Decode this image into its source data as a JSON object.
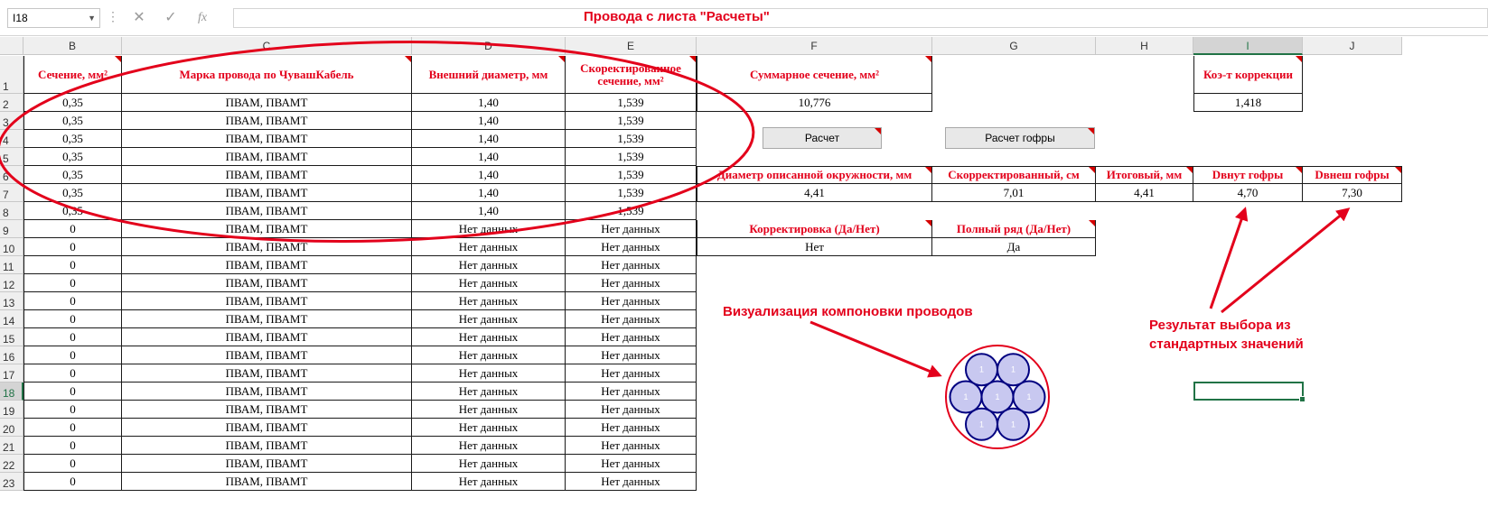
{
  "formula_bar": {
    "name_box": "I18",
    "cancel_icon": "✕",
    "enter_icon": "✓",
    "fx_icon": "fx",
    "separator": "⋮"
  },
  "columns": [
    "B",
    "C",
    "D",
    "E",
    "F",
    "G",
    "H",
    "I",
    "J"
  ],
  "rows": [
    "1",
    "2",
    "3",
    "4",
    "5",
    "6",
    "7",
    "8",
    "9",
    "10",
    "11",
    "12",
    "13",
    "14",
    "15",
    "16",
    "17",
    "18",
    "19",
    "20",
    "21",
    "22",
    "23"
  ],
  "table": {
    "headers": [
      "Сечение, мм²",
      "Марка провода по ЧувашКабель",
      "Внешний диаметр, мм",
      "Скоректированное сечение, мм²"
    ],
    "rows": [
      [
        "0,35",
        "ПВАМ, ПВАМТ",
        "1,40",
        "1,539"
      ],
      [
        "0,35",
        "ПВАМ, ПВАМТ",
        "1,40",
        "1,539"
      ],
      [
        "0,35",
        "ПВАМ, ПВАМТ",
        "1,40",
        "1,539"
      ],
      [
        "0,35",
        "ПВАМ, ПВАМТ",
        "1,40",
        "1,539"
      ],
      [
        "0,35",
        "ПВАМ, ПВАМТ",
        "1,40",
        "1,539"
      ],
      [
        "0,35",
        "ПВАМ, ПВАМТ",
        "1,40",
        "1,539"
      ],
      [
        "0,35",
        "ПВАМ, ПВАМТ",
        "1,40",
        "1,539"
      ],
      [
        "0",
        "ПВАМ, ПВАМТ",
        "Нет данных",
        "Нет данных"
      ],
      [
        "0",
        "ПВАМ, ПВАМТ",
        "Нет данных",
        "Нет данных"
      ],
      [
        "0",
        "ПВАМ, ПВАМТ",
        "Нет данных",
        "Нет данных"
      ],
      [
        "0",
        "ПВАМ, ПВАМТ",
        "Нет данных",
        "Нет данных"
      ],
      [
        "0",
        "ПВАМ, ПВАМТ",
        "Нет данных",
        "Нет данных"
      ],
      [
        "0",
        "ПВАМ, ПВАМТ",
        "Нет данных",
        "Нет данных"
      ],
      [
        "0",
        "ПВАМ, ПВАМТ",
        "Нет данных",
        "Нет данных"
      ],
      [
        "0",
        "ПВАМ, ПВАМТ",
        "Нет данных",
        "Нет данных"
      ],
      [
        "0",
        "ПВАМ, ПВАМТ",
        "Нет данных",
        "Нет данных"
      ],
      [
        "0",
        "ПВАМ, ПВАМТ",
        "Нет данных",
        "Нет данных"
      ],
      [
        "0",
        "ПВАМ, ПВАМТ",
        "Нет данных",
        "Нет данных"
      ],
      [
        "0",
        "ПВАМ, ПВАМТ",
        "Нет данных",
        "Нет данных"
      ],
      [
        "0",
        "ПВАМ, ПВАМТ",
        "Нет данных",
        "Нет данных"
      ],
      [
        "0",
        "ПВАМ, ПВАМТ",
        "Нет данных",
        "Нет данных"
      ],
      [
        "0",
        "ПВАМ, ПВАМТ",
        "Нет данных",
        "Нет данных"
      ]
    ]
  },
  "summary": {
    "total_label": "Суммарное сечение, мм²",
    "total_value": "10,776",
    "coef_label": "Коэ-т коррекции",
    "coef_value": "1,418",
    "calc_button": "Расчет",
    "calc_corrugation_button": "Расчет гофры",
    "results_headers": [
      "Диаметр описанной окружности, мм",
      "Скорректированный, см",
      "Итоговый, мм",
      "Dвнут гофры",
      "Dвнеш гофры"
    ],
    "results_values": [
      "4,41",
      "7,01",
      "4,41",
      "4,70",
      "7,30"
    ],
    "correction_label": "Корректировка (Да/Нет)",
    "correction_value": "Нет",
    "full_row_label": "Полный ряд (Да/Нет)",
    "full_row_value": "Да"
  },
  "annotations": {
    "title": "Провода с листа \"Расчеты\"",
    "visualization": "Визуализация компоновки проводов",
    "result_line1": "Результат выбора из",
    "result_line2": "стандартных значений"
  },
  "wire_label": "1",
  "colors": {
    "accent_red": "#e3001b",
    "wire_fill": "#c8c8f0",
    "wire_stroke": "#000080",
    "excel_green": "#217346"
  }
}
